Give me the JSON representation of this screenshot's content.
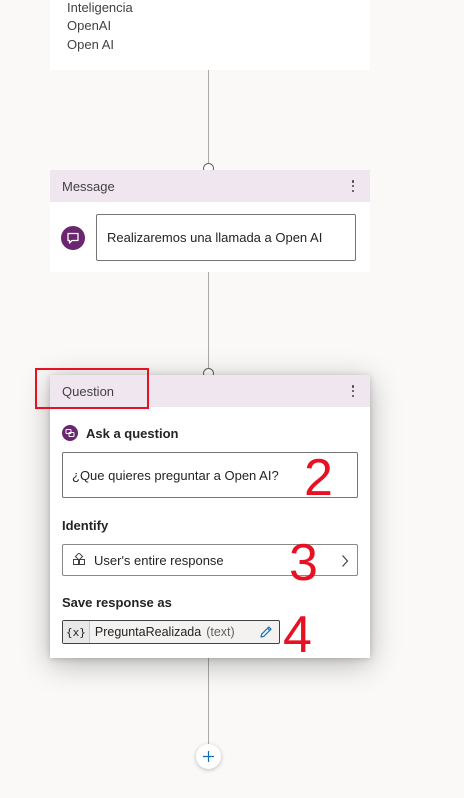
{
  "top_node": {
    "lines": [
      "Inteligencia",
      "OpenAI",
      "Open AI"
    ]
  },
  "message_node": {
    "title": "Message",
    "text": "Realizaremos una llamada a Open AI"
  },
  "question_node": {
    "title": "Question",
    "ask_label": "Ask a question",
    "question_text": "¿Que quieres preguntar a Open AI?",
    "identify_label": "Identify",
    "identify_value": "User's entire response",
    "save_label": "Save response as",
    "variable_icon": "{x}",
    "variable_name": "PreguntaRealizada",
    "variable_type": "(text)"
  },
  "annotations": [
    "2",
    "3",
    "4"
  ],
  "colors": {
    "accent": "#6b2670",
    "header_bg": "#efe6ef",
    "annotation": "#e81123"
  },
  "icons": [
    "chat-bubble-icon",
    "question-icon",
    "entity-icon",
    "chevron-right-icon",
    "pencil-icon",
    "plus-icon",
    "kebab-menu-icon"
  ]
}
